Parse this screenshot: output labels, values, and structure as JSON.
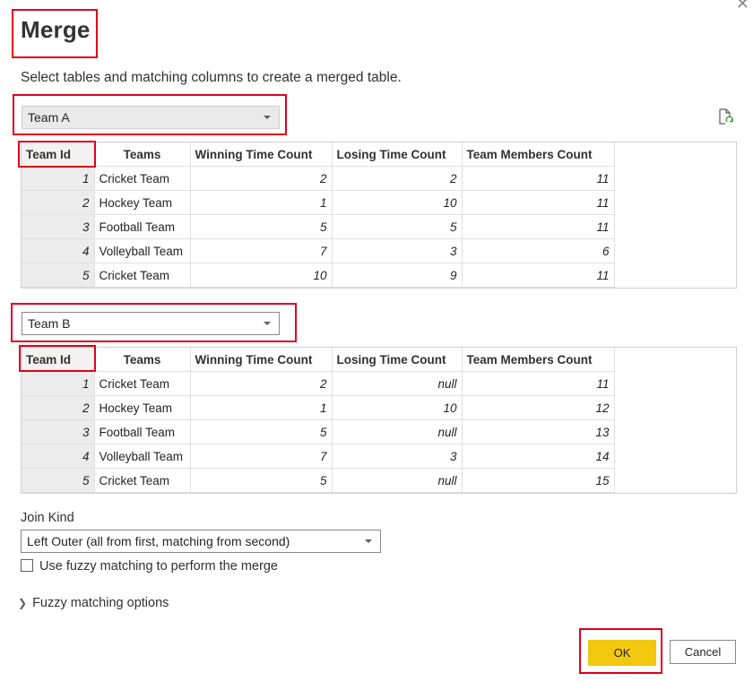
{
  "dialog": {
    "title": "Merge",
    "instructions": "Select tables and matching columns to create a merged table."
  },
  "table_a": {
    "selected": "Team A",
    "columns": [
      "Team Id",
      "Teams",
      "Winning Time Count",
      "Losing Time Count",
      "Team Members Count"
    ],
    "rows": [
      [
        "1",
        "Cricket Team",
        "2",
        "2",
        "11"
      ],
      [
        "2",
        "Hockey Team",
        "1",
        "10",
        "11"
      ],
      [
        "3",
        "Football Team",
        "5",
        "5",
        "11"
      ],
      [
        "4",
        "Volleyball Team",
        "7",
        "3",
        "6"
      ],
      [
        "5",
        "Cricket Team",
        "10",
        "9",
        "11"
      ]
    ]
  },
  "table_b": {
    "selected": "Team B",
    "columns": [
      "Team Id",
      "Teams",
      "Winning Time Count",
      "Losing Time Count",
      "Team Members Count"
    ],
    "rows": [
      [
        "1",
        "Cricket Team",
        "2",
        "null",
        "11"
      ],
      [
        "2",
        "Hockey Team",
        "1",
        "10",
        "12"
      ],
      [
        "3",
        "Football Team",
        "5",
        "null",
        "13"
      ],
      [
        "4",
        "Volleyball Team",
        "7",
        "3",
        "14"
      ],
      [
        "5",
        "Cricket Team",
        "5",
        "null",
        "15"
      ]
    ]
  },
  "join": {
    "label": "Join Kind",
    "selected": "Left Outer (all from first, matching from second)"
  },
  "fuzzy": {
    "checkbox_label": "Use fuzzy matching to perform the merge",
    "checked": false,
    "options_label": "Fuzzy matching options"
  },
  "buttons": {
    "ok": "OK",
    "cancel": "Cancel"
  },
  "colors": {
    "highlight_box": "#e0001b",
    "ok_button": "#f2c80f",
    "selected_column_header": "#f3f2f1"
  },
  "icons": {
    "refresh": "refresh-preview-icon",
    "close": "close-icon",
    "chevron": "chevron-right-icon"
  }
}
